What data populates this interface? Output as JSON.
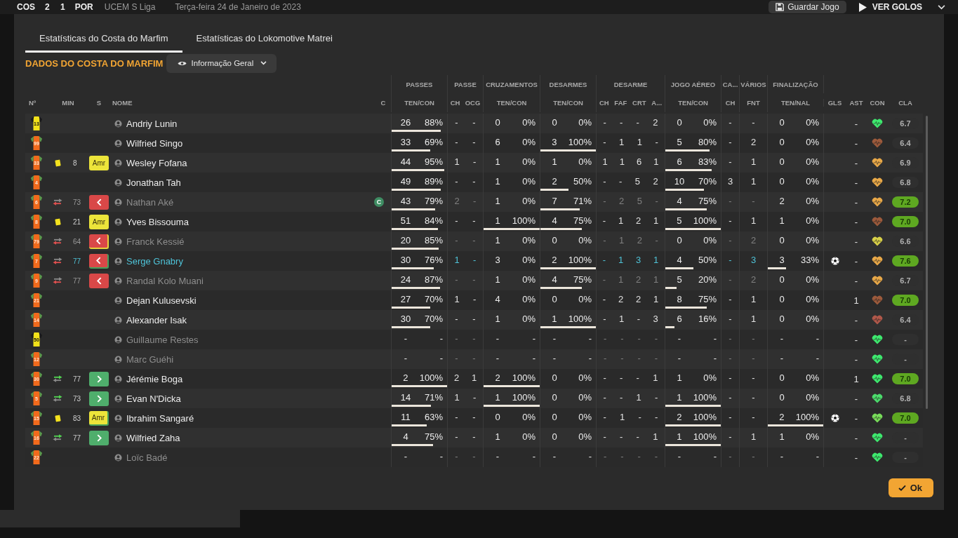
{
  "match": {
    "home": "COS",
    "score": "2 1",
    "away": "POR",
    "competition": "UCEM S Liga",
    "date": "Terça-feira 24 de Janeiro de 2023",
    "save_label": "Guardar Jogo",
    "goals_label": "VER GOLOS"
  },
  "tabs": [
    {
      "label": "Estatísticas do Costa do Marfim",
      "selected": true
    },
    {
      "label": "Estatísticas do Lokomotive Matrei",
      "selected": false
    }
  ],
  "section_title": "DADOS DO COSTA DO MARFIM",
  "view_dropdown": {
    "label": "Informação Geral"
  },
  "table": {
    "leading_columns": [
      "Nº",
      "MIN",
      "S",
      "NOME",
      "C"
    ],
    "groups": [
      {
        "title": "PASSES",
        "subs": [
          "TEN/CON"
        ]
      },
      {
        "title": "PASSE",
        "subs": [
          "CH",
          "OCG"
        ]
      },
      {
        "title": "CRUZAMENTOS",
        "subs": [
          "TEN/CON"
        ]
      },
      {
        "title": "DESARMES",
        "subs": [
          "TEN/CON"
        ]
      },
      {
        "title": "DESARME",
        "subs": [
          "CH",
          "FAF",
          "CRT",
          "A..."
        ]
      },
      {
        "title": "JOGO AÉREO",
        "subs": [
          "TEN/CON"
        ]
      },
      {
        "title": "CA...",
        "subs": [
          "CH"
        ]
      },
      {
        "title": "VÁRIOS",
        "subs": [
          "FNT"
        ]
      },
      {
        "title": "FINALIZAÇÃO",
        "subs": [
          "TEN/NAL"
        ]
      }
    ],
    "trailing_columns": [
      "GLS",
      "AST",
      "CON",
      "CLA"
    ],
    "rows": [
      {
        "shirt": {
          "kind": "keeper",
          "number": "13"
        },
        "name": "Andriy Lunin",
        "dimmed": false,
        "selected": false,
        "stats": [
          {
            "kind": "pair",
            "attempts": "26",
            "rate": "88%",
            "level": 0.88
          },
          {
            "kind": "singles",
            "values": [
              "-",
              "-"
            ]
          },
          {
            "kind": "pair",
            "attempts": "0",
            "rate": "0%"
          },
          {
            "kind": "pair",
            "attempts": "0",
            "rate": "0%"
          },
          {
            "kind": "singles",
            "values": [
              "-",
              "-",
              "-",
              "2"
            ]
          },
          {
            "kind": "pair",
            "attempts": "0",
            "rate": "0%"
          },
          {
            "kind": "singles",
            "values": [
              "-"
            ]
          },
          {
            "kind": "singles",
            "values": [
              "-"
            ]
          },
          {
            "kind": "pair",
            "attempts": "0",
            "rate": "0%"
          }
        ],
        "assists": "-",
        "condition": {
          "color": "#3ee86e"
        },
        "rating": "6.7",
        "top_rating": false
      },
      {
        "shirt": {
          "kind": "outfield",
          "number": "99"
        },
        "name": "Wilfried Singo",
        "dimmed": false,
        "selected": false,
        "stats": [
          {
            "kind": "pair",
            "attempts": "33",
            "rate": "69%",
            "level": 0.69
          },
          {
            "kind": "singles",
            "values": [
              "-",
              "-"
            ]
          },
          {
            "kind": "pair",
            "attempts": "6",
            "rate": "0%"
          },
          {
            "kind": "pair",
            "attempts": "3",
            "rate": "100%",
            "level": 1
          },
          {
            "kind": "singles",
            "values": [
              "-",
              "1",
              "1",
              "-"
            ]
          },
          {
            "kind": "pair",
            "attempts": "5",
            "rate": "80%",
            "level": 0.8
          },
          {
            "kind": "singles",
            "values": [
              "-"
            ]
          },
          {
            "kind": "singles",
            "values": [
              "2"
            ]
          },
          {
            "kind": "pair",
            "attempts": "0",
            "rate": "0%"
          }
        ],
        "assists": "-",
        "condition": {
          "color": "#9c5a3c"
        },
        "rating": "6.4",
        "top_rating": false
      },
      {
        "shirt": {
          "kind": "outfield",
          "number": "33"
        },
        "event_icon": {
          "kind": "yellow_card"
        },
        "minute": "8",
        "badge": {
          "kind": "booked",
          "label": "Amr"
        },
        "name": "Wesley Fofana",
        "dimmed": false,
        "selected": false,
        "stats": [
          {
            "kind": "pair",
            "attempts": "44",
            "rate": "95%",
            "level": 0.95
          },
          {
            "kind": "singles",
            "values": [
              "1",
              "-"
            ]
          },
          {
            "kind": "pair",
            "attempts": "1",
            "rate": "0%"
          },
          {
            "kind": "pair",
            "attempts": "1",
            "rate": "0%"
          },
          {
            "kind": "singles",
            "values": [
              "1",
              "1",
              "6",
              "1"
            ]
          },
          {
            "kind": "pair",
            "attempts": "6",
            "rate": "83%",
            "level": 0.83
          },
          {
            "kind": "singles",
            "values": [
              "-"
            ]
          },
          {
            "kind": "singles",
            "values": [
              "1"
            ]
          },
          {
            "kind": "pair",
            "attempts": "0",
            "rate": "0%"
          }
        ],
        "assists": "-",
        "condition": {
          "color": "#e8a848"
        },
        "rating": "6.9",
        "top_rating": false
      },
      {
        "shirt": {
          "kind": "outfield",
          "number": "4"
        },
        "name": "Jonathan Tah",
        "dimmed": false,
        "selected": false,
        "stats": [
          {
            "kind": "pair",
            "attempts": "49",
            "rate": "89%",
            "level": 0.89
          },
          {
            "kind": "singles",
            "values": [
              "-",
              "-"
            ]
          },
          {
            "kind": "pair",
            "attempts": "1",
            "rate": "0%"
          },
          {
            "kind": "pair",
            "attempts": "2",
            "rate": "50%",
            "level": 0.5
          },
          {
            "kind": "singles",
            "values": [
              "-",
              "-",
              "5",
              "2"
            ]
          },
          {
            "kind": "pair",
            "attempts": "10",
            "rate": "70%",
            "level": 0.7
          },
          {
            "kind": "singles",
            "values": [
              "3"
            ]
          },
          {
            "kind": "singles",
            "values": [
              "1"
            ]
          },
          {
            "kind": "pair",
            "attempts": "0",
            "rate": "0%"
          }
        ],
        "assists": "-",
        "condition": {
          "color": "#e8a848"
        },
        "rating": "6.8",
        "top_rating": false
      },
      {
        "shirt": {
          "kind": "outfield",
          "number": "6"
        },
        "event_icon": {
          "kind": "sub_off"
        },
        "minute": "73",
        "badge": {
          "kind": "off"
        },
        "name": "Nathan Aké",
        "captain": "C",
        "dimmed": true,
        "selected": false,
        "stats": [
          {
            "kind": "pair",
            "attempts": "43",
            "rate": "79%",
            "level": 0.79
          },
          {
            "kind": "singles",
            "values": [
              "2",
              "-"
            ]
          },
          {
            "kind": "pair",
            "attempts": "1",
            "rate": "0%"
          },
          {
            "kind": "pair",
            "attempts": "7",
            "rate": "71%",
            "level": 0.71
          },
          {
            "kind": "singles",
            "values": [
              "-",
              "2",
              "5",
              "-"
            ]
          },
          {
            "kind": "pair",
            "attempts": "4",
            "rate": "75%",
            "level": 0.75
          },
          {
            "kind": "singles",
            "values": [
              "-"
            ]
          },
          {
            "kind": "singles",
            "values": [
              "-"
            ]
          },
          {
            "kind": "pair",
            "attempts": "2",
            "rate": "0%"
          }
        ],
        "assists": "-",
        "condition": {
          "color": "#e8a848"
        },
        "rating": "7.2",
        "top_rating": true
      },
      {
        "shirt": {
          "kind": "outfield",
          "number": "8"
        },
        "event_icon": {
          "kind": "yellow_card"
        },
        "minute": "21",
        "badge": {
          "kind": "booked",
          "label": "Amr"
        },
        "name": "Yves Bissouma",
        "dimmed": false,
        "selected": false,
        "stats": [
          {
            "kind": "pair",
            "attempts": "51",
            "rate": "84%",
            "level": 0.84
          },
          {
            "kind": "singles",
            "values": [
              "-",
              "-"
            ]
          },
          {
            "kind": "pair",
            "attempts": "1",
            "rate": "100%",
            "level": 1
          },
          {
            "kind": "pair",
            "attempts": "4",
            "rate": "75%",
            "level": 0.75
          },
          {
            "kind": "singles",
            "values": [
              "-",
              "1",
              "2",
              "1"
            ]
          },
          {
            "kind": "pair",
            "attempts": "5",
            "rate": "100%",
            "level": 1
          },
          {
            "kind": "singles",
            "values": [
              "-"
            ]
          },
          {
            "kind": "singles",
            "values": [
              "1"
            ]
          },
          {
            "kind": "pair",
            "attempts": "1",
            "rate": "0%"
          }
        ],
        "assists": "-",
        "condition": {
          "color": "#9c5a3c"
        },
        "rating": "7.0",
        "top_rating": true
      },
      {
        "shirt": {
          "kind": "outfield",
          "number": "79"
        },
        "event_icon": {
          "kind": "sub_off"
        },
        "minute": "64",
        "badge": {
          "kind": "off",
          "under": {
            "kind": "booked"
          }
        },
        "name": "Franck Kessié",
        "dimmed": true,
        "selected": false,
        "stats": [
          {
            "kind": "pair",
            "attempts": "20",
            "rate": "85%",
            "level": 0.85
          },
          {
            "kind": "singles",
            "values": [
              "-",
              "-"
            ]
          },
          {
            "kind": "pair",
            "attempts": "1",
            "rate": "0%"
          },
          {
            "kind": "pair",
            "attempts": "0",
            "rate": "0%"
          },
          {
            "kind": "singles",
            "values": [
              "-",
              "1",
              "2",
              "-"
            ]
          },
          {
            "kind": "pair",
            "attempts": "0",
            "rate": "0%"
          },
          {
            "kind": "singles",
            "values": [
              "-"
            ]
          },
          {
            "kind": "singles",
            "values": [
              "2"
            ]
          },
          {
            "kind": "pair",
            "attempts": "0",
            "rate": "0%"
          }
        ],
        "assists": "-",
        "condition": {
          "color": "#d8d048"
        },
        "rating": "6.6",
        "top_rating": false
      },
      {
        "shirt": {
          "kind": "outfield",
          "number": "7"
        },
        "event_icon": {
          "kind": "sub_off"
        },
        "minute": "77",
        "badge": {
          "kind": "off",
          "under": {
            "kind": "on"
          }
        },
        "name": "Serge Gnabry",
        "dimmed": false,
        "selected": true,
        "stats": [
          {
            "kind": "pair",
            "attempts": "30",
            "rate": "76%",
            "level": 0.76
          },
          {
            "kind": "singles",
            "values": [
              "1",
              "-"
            ]
          },
          {
            "kind": "pair",
            "attempts": "3",
            "rate": "0%"
          },
          {
            "kind": "pair",
            "attempts": "2",
            "rate": "100%",
            "level": 1
          },
          {
            "kind": "singles",
            "values": [
              "-",
              "1",
              "3",
              "1"
            ]
          },
          {
            "kind": "pair",
            "attempts": "4",
            "rate": "50%",
            "level": 0.5
          },
          {
            "kind": "singles",
            "values": [
              "-"
            ]
          },
          {
            "kind": "singles",
            "values": [
              "3"
            ]
          },
          {
            "kind": "pair",
            "attempts": "3",
            "rate": "33%",
            "level": 0.33
          }
        ],
        "goal_icon": {
          "kind": "ball"
        },
        "assists": "-",
        "condition": {
          "color": "#e8a848"
        },
        "rating": "7.6",
        "top_rating": true
      },
      {
        "shirt": {
          "kind": "outfield",
          "number": "9"
        },
        "event_icon": {
          "kind": "sub_off"
        },
        "minute": "77",
        "badge": {
          "kind": "off"
        },
        "name": "Randal Kolo Muani",
        "dimmed": true,
        "selected": false,
        "stats": [
          {
            "kind": "pair",
            "attempts": "24",
            "rate": "87%",
            "level": 0.87
          },
          {
            "kind": "singles",
            "values": [
              "-",
              "-"
            ]
          },
          {
            "kind": "pair",
            "attempts": "1",
            "rate": "0%"
          },
          {
            "kind": "pair",
            "attempts": "4",
            "rate": "75%",
            "level": 0.75
          },
          {
            "kind": "singles",
            "values": [
              "-",
              "1",
              "2",
              "1"
            ]
          },
          {
            "kind": "pair",
            "attempts": "5",
            "rate": "20%",
            "level": 0.2
          },
          {
            "kind": "singles",
            "values": [
              "-"
            ]
          },
          {
            "kind": "singles",
            "values": [
              "2"
            ]
          },
          {
            "kind": "pair",
            "attempts": "0",
            "rate": "0%"
          }
        ],
        "assists": "-",
        "condition": {
          "color": "#e8a848"
        },
        "rating": "6.7",
        "top_rating": false
      },
      {
        "shirt": {
          "kind": "outfield",
          "number": "21"
        },
        "name": "Dejan Kulusevski",
        "dimmed": false,
        "selected": false,
        "stats": [
          {
            "kind": "pair",
            "attempts": "27",
            "rate": "70%",
            "level": 0.7
          },
          {
            "kind": "singles",
            "values": [
              "1",
              "-"
            ]
          },
          {
            "kind": "pair",
            "attempts": "4",
            "rate": "0%"
          },
          {
            "kind": "pair",
            "attempts": "0",
            "rate": "0%"
          },
          {
            "kind": "singles",
            "values": [
              "-",
              "2",
              "2",
              "1"
            ]
          },
          {
            "kind": "pair",
            "attempts": "8",
            "rate": "75%",
            "level": 0.75
          },
          {
            "kind": "singles",
            "values": [
              "-"
            ]
          },
          {
            "kind": "singles",
            "values": [
              "1"
            ]
          },
          {
            "kind": "pair",
            "attempts": "0",
            "rate": "0%"
          }
        ],
        "assists": "1",
        "condition": {
          "color": "#9c5a3c"
        },
        "rating": "7.0",
        "top_rating": true
      },
      {
        "shirt": {
          "kind": "outfield",
          "number": "14"
        },
        "name": "Alexander Isak",
        "dimmed": false,
        "selected": false,
        "stats": [
          {
            "kind": "pair",
            "attempts": "30",
            "rate": "70%",
            "level": 0.7
          },
          {
            "kind": "singles",
            "values": [
              "-",
              "-"
            ]
          },
          {
            "kind": "pair",
            "attempts": "1",
            "rate": "0%"
          },
          {
            "kind": "pair",
            "attempts": "1",
            "rate": "100%",
            "level": 1
          },
          {
            "kind": "singles",
            "values": [
              "-",
              "1",
              "-",
              "3"
            ]
          },
          {
            "kind": "pair",
            "attempts": "6",
            "rate": "16%",
            "level": 0.16
          },
          {
            "kind": "singles",
            "values": [
              "-"
            ]
          },
          {
            "kind": "singles",
            "values": [
              "1"
            ]
          },
          {
            "kind": "pair",
            "attempts": "0",
            "rate": "0%"
          }
        ],
        "assists": "-",
        "condition": {
          "color": "#b0584a"
        },
        "rating": "6.4",
        "top_rating": false
      },
      {
        "shirt": {
          "kind": "keeper",
          "number": "50"
        },
        "name": "Guillaume Restes",
        "dimmed": true,
        "selected": false,
        "stats": [
          {
            "kind": "pair",
            "attempts": "-",
            "rate": "-"
          },
          {
            "kind": "singles",
            "values": [
              "-",
              "-"
            ]
          },
          {
            "kind": "pair",
            "attempts": "-",
            "rate": "-"
          },
          {
            "kind": "pair",
            "attempts": "-",
            "rate": "-"
          },
          {
            "kind": "singles",
            "values": [
              "-",
              "-",
              "-",
              "-"
            ]
          },
          {
            "kind": "pair",
            "attempts": "-",
            "rate": "-"
          },
          {
            "kind": "singles",
            "values": [
              "-"
            ]
          },
          {
            "kind": "singles",
            "values": [
              "-"
            ]
          },
          {
            "kind": "pair",
            "attempts": "-",
            "rate": "-"
          }
        ],
        "assists": "-",
        "condition": {
          "color": "#3ee86e"
        },
        "rating": "-",
        "top_rating": false
      },
      {
        "shirt": {
          "kind": "outfield",
          "number": "12"
        },
        "name": "Marc Guéhi",
        "dimmed": true,
        "selected": false,
        "stats": [
          {
            "kind": "pair",
            "attempts": "-",
            "rate": "-"
          },
          {
            "kind": "singles",
            "values": [
              "-",
              "-"
            ]
          },
          {
            "kind": "pair",
            "attempts": "-",
            "rate": "-"
          },
          {
            "kind": "pair",
            "attempts": "-",
            "rate": "-"
          },
          {
            "kind": "singles",
            "values": [
              "-",
              "-",
              "-",
              "-"
            ]
          },
          {
            "kind": "pair",
            "attempts": "-",
            "rate": "-"
          },
          {
            "kind": "singles",
            "values": [
              "-"
            ]
          },
          {
            "kind": "singles",
            "values": [
              "-"
            ]
          },
          {
            "kind": "pair",
            "attempts": "-",
            "rate": "-"
          }
        ],
        "assists": "-",
        "condition": {
          "color": "#3ee86e"
        },
        "rating": "-",
        "top_rating": false
      },
      {
        "shirt": {
          "kind": "outfield",
          "number": "30"
        },
        "event_icon": {
          "kind": "sub_on"
        },
        "minute": "77",
        "badge": {
          "kind": "on"
        },
        "name": "Jérémie Boga",
        "dimmed": false,
        "selected": false,
        "stats": [
          {
            "kind": "pair",
            "attempts": "2",
            "rate": "100%",
            "level": 1
          },
          {
            "kind": "singles",
            "values": [
              "2",
              "1"
            ]
          },
          {
            "kind": "pair",
            "attempts": "2",
            "rate": "100%",
            "level": 1
          },
          {
            "kind": "pair",
            "attempts": "0",
            "rate": "0%"
          },
          {
            "kind": "singles",
            "values": [
              "-",
              "-",
              "-",
              "1"
            ]
          },
          {
            "kind": "pair",
            "attempts": "1",
            "rate": "0%"
          },
          {
            "kind": "singles",
            "values": [
              "-"
            ]
          },
          {
            "kind": "singles",
            "values": [
              "-"
            ]
          },
          {
            "kind": "pair",
            "attempts": "0",
            "rate": "0%"
          }
        ],
        "assists": "1",
        "condition": {
          "color": "#3ee86e"
        },
        "rating": "7.0",
        "top_rating": true
      },
      {
        "shirt": {
          "kind": "outfield",
          "number": "5"
        },
        "event_icon": {
          "kind": "sub_on"
        },
        "minute": "73",
        "badge": {
          "kind": "on"
        },
        "name": "Evan N'Dicka",
        "dimmed": false,
        "selected": false,
        "stats": [
          {
            "kind": "pair",
            "attempts": "14",
            "rate": "71%",
            "level": 0.71
          },
          {
            "kind": "singles",
            "values": [
              "1",
              "-"
            ]
          },
          {
            "kind": "pair",
            "attempts": "1",
            "rate": "100%",
            "level": 1
          },
          {
            "kind": "pair",
            "attempts": "0",
            "rate": "0%"
          },
          {
            "kind": "singles",
            "values": [
              "-",
              "-",
              "1",
              "-"
            ]
          },
          {
            "kind": "pair",
            "attempts": "1",
            "rate": "100%",
            "level": 1
          },
          {
            "kind": "singles",
            "values": [
              "-"
            ]
          },
          {
            "kind": "singles",
            "values": [
              "-"
            ]
          },
          {
            "kind": "pair",
            "attempts": "0",
            "rate": "0%"
          }
        ],
        "assists": "-",
        "condition": {
          "color": "#4cdc6c"
        },
        "rating": "6.8",
        "top_rating": false
      },
      {
        "shirt": {
          "kind": "outfield",
          "number": "15"
        },
        "event_icon": {
          "kind": "yellow_card"
        },
        "minute": "83",
        "badge": {
          "kind": "booked",
          "label": "Amr",
          "under": {
            "kind": "on"
          }
        },
        "name": "Ibrahim Sangaré",
        "dimmed": false,
        "selected": false,
        "stats": [
          {
            "kind": "pair",
            "attempts": "11",
            "rate": "63%",
            "level": 0.63
          },
          {
            "kind": "singles",
            "values": [
              "-",
              "-"
            ]
          },
          {
            "kind": "pair",
            "attempts": "0",
            "rate": "0%"
          },
          {
            "kind": "pair",
            "attempts": "0",
            "rate": "0%"
          },
          {
            "kind": "singles",
            "values": [
              "-",
              "1",
              "-",
              "-"
            ]
          },
          {
            "kind": "pair",
            "attempts": "2",
            "rate": "100%",
            "level": 1
          },
          {
            "kind": "singles",
            "values": [
              "-"
            ]
          },
          {
            "kind": "singles",
            "values": [
              "-"
            ]
          },
          {
            "kind": "pair",
            "attempts": "2",
            "rate": "100%",
            "level": 1
          }
        ],
        "goal_icon": {
          "kind": "ball"
        },
        "assists": "-",
        "condition": {
          "color": "#78dc5a"
        },
        "rating": "7.0",
        "top_rating": true
      },
      {
        "shirt": {
          "kind": "outfield",
          "number": "16"
        },
        "event_icon": {
          "kind": "sub_on"
        },
        "minute": "77",
        "badge": {
          "kind": "on"
        },
        "name": "Wilfried Zaha",
        "dimmed": false,
        "selected": false,
        "stats": [
          {
            "kind": "pair",
            "attempts": "4",
            "rate": "75%",
            "level": 0.75
          },
          {
            "kind": "singles",
            "values": [
              "-",
              "-"
            ]
          },
          {
            "kind": "pair",
            "attempts": "1",
            "rate": "0%"
          },
          {
            "kind": "pair",
            "attempts": "0",
            "rate": "0%"
          },
          {
            "kind": "singles",
            "values": [
              "-",
              "-",
              "-",
              "1"
            ]
          },
          {
            "kind": "pair",
            "attempts": "1",
            "rate": "100%",
            "level": 1
          },
          {
            "kind": "singles",
            "values": [
              "-"
            ]
          },
          {
            "kind": "singles",
            "values": [
              "1"
            ]
          },
          {
            "kind": "pair",
            "attempts": "1",
            "rate": "0%"
          }
        ],
        "assists": "-",
        "condition": {
          "color": "#3ee86e"
        },
        "rating": "-",
        "top_rating": false
      },
      {
        "shirt": {
          "kind": "outfield",
          "number": "22"
        },
        "name": "Loïc Badé",
        "dimmed": true,
        "selected": false,
        "stats": [
          {
            "kind": "pair",
            "attempts": "-",
            "rate": "-"
          },
          {
            "kind": "singles",
            "values": [
              "-",
              "-"
            ]
          },
          {
            "kind": "pair",
            "attempts": "-",
            "rate": "-"
          },
          {
            "kind": "pair",
            "attempts": "-",
            "rate": "-"
          },
          {
            "kind": "singles",
            "values": [
              "-",
              "-",
              "-",
              "-"
            ]
          },
          {
            "kind": "pair",
            "attempts": "-",
            "rate": "-"
          },
          {
            "kind": "singles",
            "values": [
              "-"
            ]
          },
          {
            "kind": "singles",
            "values": [
              "-"
            ]
          },
          {
            "kind": "pair",
            "attempts": "-",
            "rate": "-"
          }
        ],
        "assists": "-",
        "condition": {
          "color": "#3ee86e"
        },
        "rating": "-",
        "top_rating": false
      }
    ]
  },
  "ok_button": {
    "label": "Ok"
  }
}
